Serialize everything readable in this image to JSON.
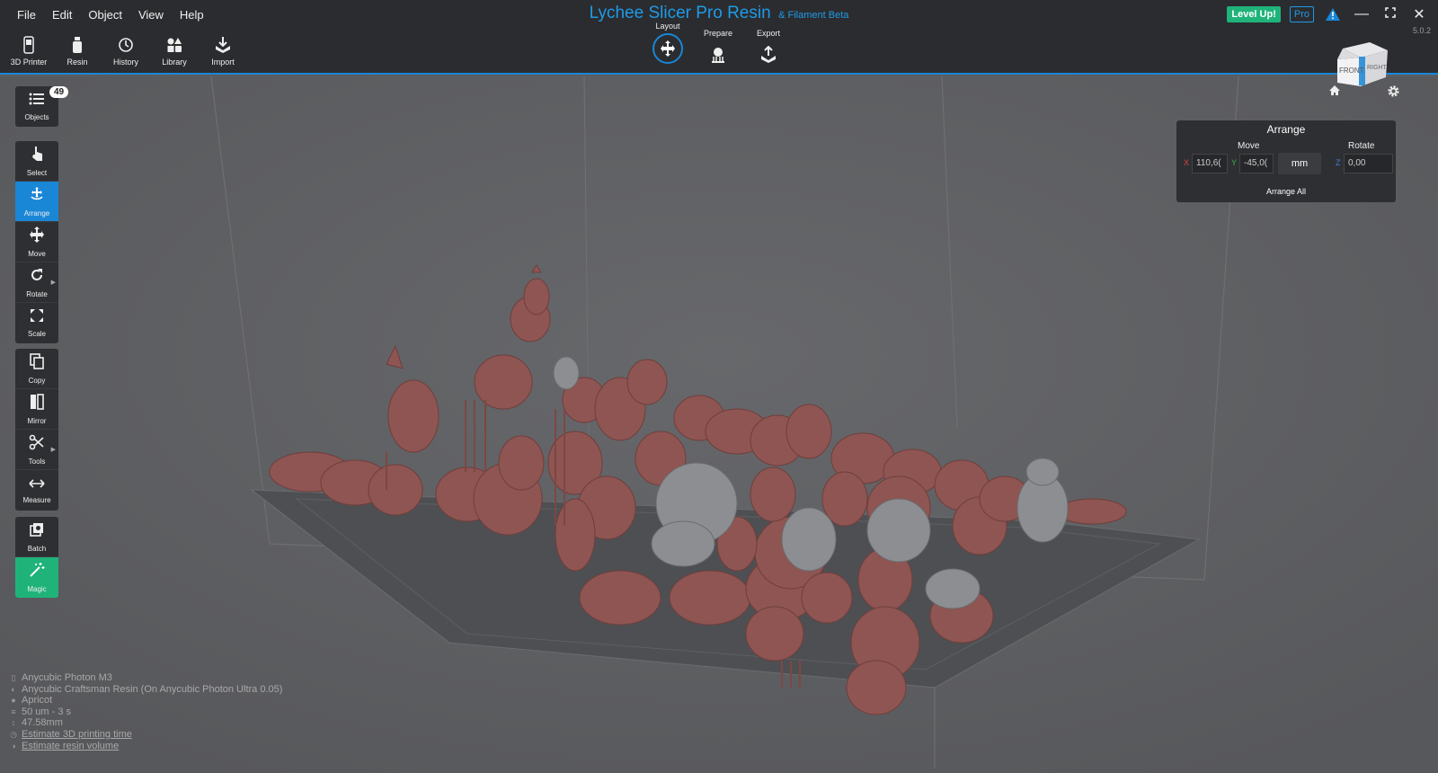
{
  "menu": [
    "File",
    "Edit",
    "Object",
    "View",
    "Help"
  ],
  "app": {
    "title": "Lychee Slicer Pro Resin",
    "subtitle": "& Filament Beta",
    "version": "5.0.2"
  },
  "top_right": {
    "level_up": "Level Up!",
    "pro": "Pro"
  },
  "toolbar": [
    {
      "label": "3D Printer",
      "icon": "printer-icon"
    },
    {
      "label": "Resin",
      "icon": "resin-bottle-icon"
    },
    {
      "label": "History",
      "icon": "history-icon"
    },
    {
      "label": "Library",
      "icon": "library-icon"
    },
    {
      "label": "Import",
      "icon": "import-icon"
    }
  ],
  "modes": [
    {
      "label": "Layout",
      "icon": "move-arrows-icon",
      "active": true
    },
    {
      "label": "Prepare",
      "icon": "supports-icon"
    },
    {
      "label": "Export",
      "icon": "export-icon"
    }
  ],
  "left_tools": {
    "objects": {
      "label": "Objects",
      "count": "49"
    },
    "main": [
      {
        "label": "Select",
        "icon": "pointer-icon"
      },
      {
        "label": "Arrange",
        "icon": "arrange-icon",
        "active": true
      },
      {
        "label": "Move",
        "icon": "move-icon"
      },
      {
        "label": "Rotate",
        "icon": "rotate-icon"
      },
      {
        "label": "Scale",
        "icon": "scale-icon"
      }
    ],
    "edit": [
      {
        "label": "Copy",
        "icon": "copy-icon"
      },
      {
        "label": "Mirror",
        "icon": "mirror-icon"
      },
      {
        "label": "Tools",
        "icon": "scissors-icon"
      },
      {
        "label": "Measure",
        "icon": "measure-icon"
      }
    ],
    "batch": {
      "label": "Batch",
      "icon": "batch-icon"
    },
    "magic": {
      "label": "Magic",
      "icon": "magic-wand-icon"
    }
  },
  "arrange_panel": {
    "title": "Arrange",
    "move_label": "Move",
    "rotate_label": "Rotate",
    "x_label": "X",
    "x_value": "110,6(",
    "y_label": "Y",
    "y_value": "-45,0(",
    "unit": "mm",
    "z_label": "Z",
    "z_value": "0,00",
    "action": "Arrange All"
  },
  "viewcube": {
    "front": "FRONT",
    "right": "RIGHT"
  },
  "status": [
    {
      "icon": "printer-icon",
      "text": "Anycubic Photon M3",
      "link": false
    },
    {
      "icon": "resin-icon",
      "text": "Anycubic Craftsman Resin (On Anycubic Photon Ultra 0.05)",
      "link": false
    },
    {
      "icon": "palette-icon",
      "text": "Apricot",
      "link": false
    },
    {
      "icon": "layers-icon",
      "text": "50 um - 3 s",
      "link": false
    },
    {
      "icon": "height-icon",
      "text": "47.58mm",
      "link": false
    },
    {
      "icon": "clock-icon",
      "text": "Estimate 3D printing time",
      "link": true
    },
    {
      "icon": "volume-icon",
      "text": "Estimate resin volume",
      "link": true
    }
  ],
  "colors": {
    "accent": "#1a86d6",
    "green": "#1fb37a",
    "model": "#8e5552",
    "model_selected": "#8c8e92",
    "bg": "#5d5e61"
  }
}
